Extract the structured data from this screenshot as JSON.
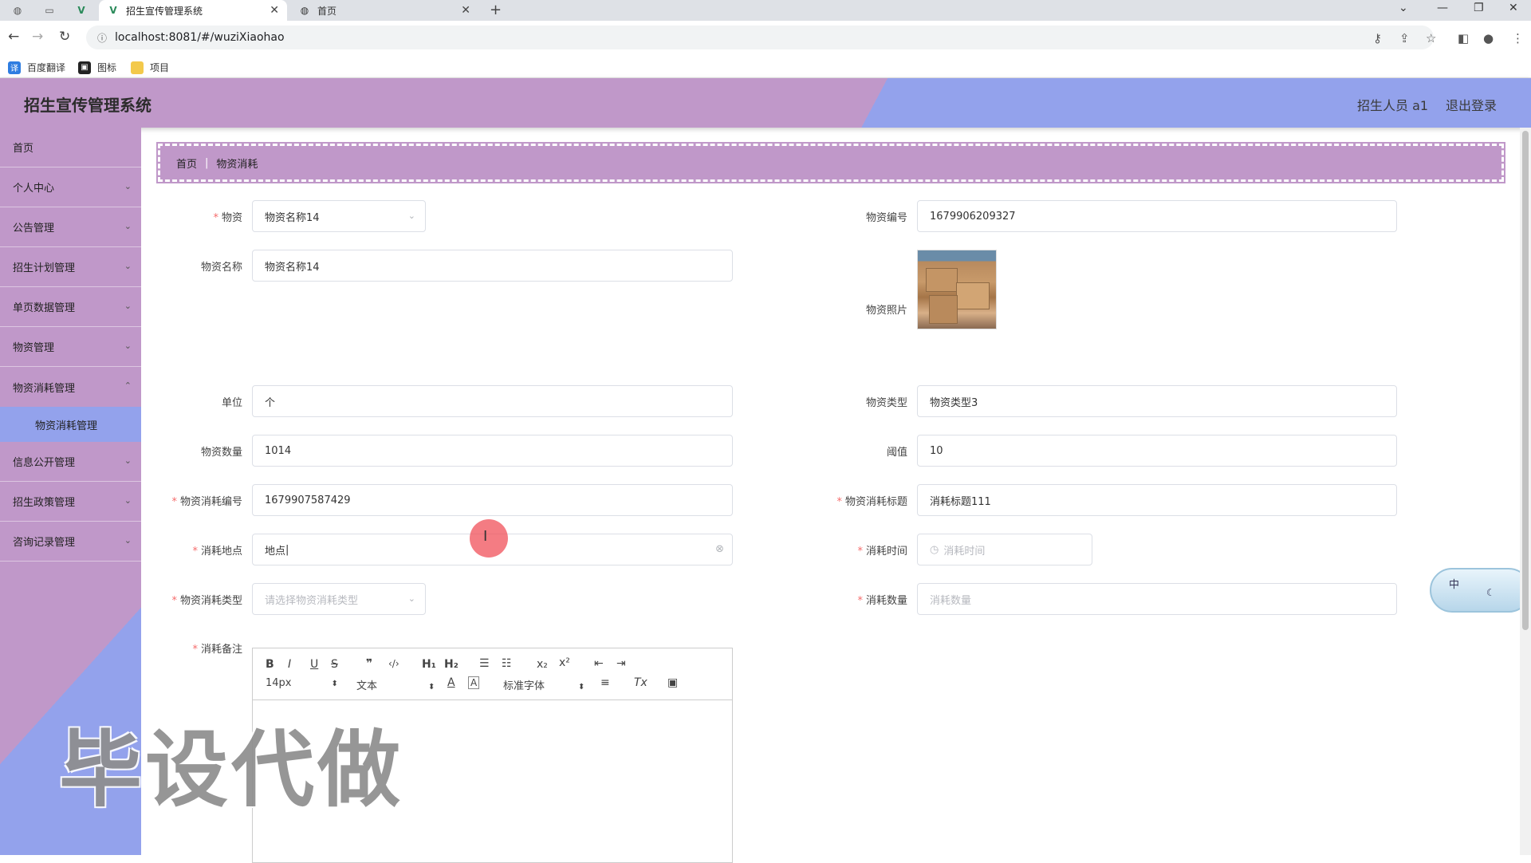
{
  "browser": {
    "tabs": [
      {
        "title": "招生宣传管理系统",
        "active": true
      },
      {
        "title": "首页",
        "active": false
      }
    ],
    "new_tab": "+",
    "url": "localhost:8081/#/wuziXiaohao",
    "bookmarks": [
      "百度翻译",
      "图标",
      "项目"
    ]
  },
  "header": {
    "title": "招生宣传管理系统",
    "user": "招生人员 a1",
    "logout": "退出登录",
    "colors": {
      "pink": "#c098c9",
      "blue": "#93a2ec"
    }
  },
  "sidebar": {
    "items": [
      {
        "label": "首页",
        "expandable": false
      },
      {
        "label": "个人中心",
        "expandable": true
      },
      {
        "label": "公告管理",
        "expandable": true
      },
      {
        "label": "招生计划管理",
        "expandable": true
      },
      {
        "label": "单页数据管理",
        "expandable": true
      },
      {
        "label": "物资管理",
        "expandable": true
      },
      {
        "label": "物资消耗管理",
        "expandable": true
      },
      {
        "label": "信息公开管理",
        "expandable": true
      },
      {
        "label": "招生政策管理",
        "expandable": true
      },
      {
        "label": "咨询记录管理",
        "expandable": true
      }
    ],
    "sub_item": "物资消耗管理"
  },
  "breadcrumb": {
    "home": "首页",
    "current": "物资消耗"
  },
  "form": {
    "wuzi_label": "物资",
    "wuzi_value": "物资名称14",
    "bianhao_label": "物资编号",
    "bianhao_value": "1679906209327",
    "mingcheng_label": "物资名称",
    "mingcheng_value": "物资名称14",
    "photo_label": "物资照片",
    "danwei_label": "单位",
    "danwei_value": "个",
    "leixing_label": "物资类型",
    "leixing_value": "物资类型3",
    "shuliang_label": "物资数量",
    "shuliang_value": "1014",
    "yuzhi_label": "阈值",
    "yuzhi_value": "10",
    "xh_bianhao_label": "物资消耗编号",
    "xh_bianhao_value": "1679907587429",
    "xh_biaoti_label": "物资消耗标题",
    "xh_biaoti_value": "消耗标题111",
    "didian_label": "消耗地点",
    "didian_value": "地点",
    "shijian_label": "消耗时间",
    "shijian_placeholder": "消耗时间",
    "xh_leixing_label": "物资消耗类型",
    "xh_leixing_placeholder": "请选择物资消耗类型",
    "xh_shuliang_label": "消耗数量",
    "xh_shuliang_placeholder": "消耗数量",
    "beizhu_label": "消耗备注",
    "required_mark": "*"
  },
  "editor": {
    "font_size": "14px",
    "format": "文本",
    "font_family": "标准字体"
  },
  "watermark": "毕设代做",
  "ime": {
    "label": "中"
  }
}
